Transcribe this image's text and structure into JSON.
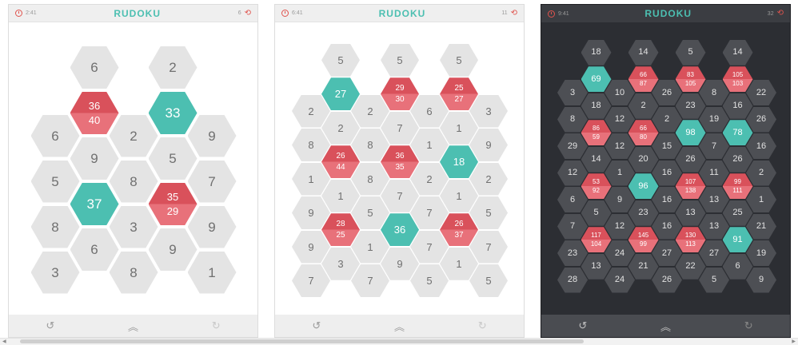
{
  "screens": [
    {
      "id": "s1",
      "theme": "light",
      "time": "2:41",
      "moves": "6",
      "title": "RUDOKU",
      "bottom_icons": [
        "undo-icon",
        "menu-icon",
        "redo-icon"
      ],
      "cells": [
        {
          "c": 1,
          "r": 1,
          "v": [
            "6"
          ]
        },
        {
          "c": 3,
          "r": 1,
          "v": [
            "2"
          ]
        },
        {
          "c": 0,
          "r": 2,
          "v": [
            "6"
          ]
        },
        {
          "c": 1,
          "r": 2,
          "v": [
            "36",
            "40"
          ],
          "t": "red"
        },
        {
          "c": 2,
          "r": 2,
          "v": [
            "2"
          ]
        },
        {
          "c": 3,
          "r": 2,
          "v": [
            "33"
          ],
          "t": "teal"
        },
        {
          "c": 4,
          "r": 2,
          "v": [
            "9"
          ]
        },
        {
          "c": 0,
          "r": 3,
          "v": [
            "5"
          ]
        },
        {
          "c": 1,
          "r": 3,
          "v": [
            "9"
          ]
        },
        {
          "c": 2,
          "r": 3,
          "v": [
            "8"
          ]
        },
        {
          "c": 3,
          "r": 3,
          "v": [
            "5"
          ]
        },
        {
          "c": 4,
          "r": 3,
          "v": [
            "7"
          ]
        },
        {
          "c": 0,
          "r": 4,
          "v": [
            "8"
          ]
        },
        {
          "c": 1,
          "r": 4,
          "v": [
            "37"
          ],
          "t": "teal"
        },
        {
          "c": 2,
          "r": 4,
          "v": [
            "3"
          ]
        },
        {
          "c": 3,
          "r": 4,
          "v": [
            "35",
            "29"
          ],
          "t": "red"
        },
        {
          "c": 4,
          "r": 4,
          "v": [
            "9"
          ]
        },
        {
          "c": 0,
          "r": 5,
          "v": [
            "3"
          ]
        },
        {
          "c": 1,
          "r": 5,
          "v": [
            "6"
          ]
        },
        {
          "c": 2,
          "r": 5,
          "v": [
            "8"
          ]
        },
        {
          "c": 3,
          "r": 5,
          "v": [
            "9"
          ]
        },
        {
          "c": 4,
          "r": 5,
          "v": [
            "1"
          ]
        }
      ]
    },
    {
      "id": "s2",
      "theme": "light",
      "time": "6:41",
      "moves": "11",
      "title": "RUDOKU",
      "bottom_icons": [
        "undo-icon",
        "menu-icon",
        "redo-icon"
      ],
      "cells": [
        {
          "c": 1,
          "r": 1,
          "v": [
            "5"
          ]
        },
        {
          "c": 3,
          "r": 1,
          "v": [
            "5"
          ]
        },
        {
          "c": 5,
          "r": 1,
          "v": [
            "5"
          ]
        },
        {
          "c": 0,
          "r": 2,
          "v": [
            "2"
          ]
        },
        {
          "c": 1,
          "r": 2,
          "v": [
            "27"
          ],
          "t": "teal"
        },
        {
          "c": 2,
          "r": 2,
          "v": [
            "2"
          ]
        },
        {
          "c": 3,
          "r": 2,
          "v": [
            "29",
            "30"
          ],
          "t": "red"
        },
        {
          "c": 4,
          "r": 2,
          "v": [
            "6"
          ]
        },
        {
          "c": 5,
          "r": 2,
          "v": [
            "25",
            "27"
          ],
          "t": "red"
        },
        {
          "c": 6,
          "r": 2,
          "v": [
            "3"
          ]
        },
        {
          "c": 0,
          "r": 3,
          "v": [
            "8"
          ]
        },
        {
          "c": 1,
          "r": 3,
          "v": [
            "2"
          ]
        },
        {
          "c": 2,
          "r": 3,
          "v": [
            "8"
          ]
        },
        {
          "c": 3,
          "r": 3,
          "v": [
            "7"
          ]
        },
        {
          "c": 4,
          "r": 3,
          "v": [
            "1"
          ]
        },
        {
          "c": 5,
          "r": 3,
          "v": [
            "1"
          ]
        },
        {
          "c": 6,
          "r": 3,
          "v": [
            "9"
          ]
        },
        {
          "c": 0,
          "r": 4,
          "v": [
            "1"
          ]
        },
        {
          "c": 1,
          "r": 4,
          "v": [
            "26",
            "44"
          ],
          "t": "red"
        },
        {
          "c": 2,
          "r": 4,
          "v": [
            "8"
          ]
        },
        {
          "c": 3,
          "r": 4,
          "v": [
            "36",
            "35"
          ],
          "t": "red"
        },
        {
          "c": 4,
          "r": 4,
          "v": [
            "2"
          ]
        },
        {
          "c": 5,
          "r": 4,
          "v": [
            "18"
          ],
          "t": "teal"
        },
        {
          "c": 6,
          "r": 4,
          "v": [
            "2"
          ]
        },
        {
          "c": 0,
          "r": 5,
          "v": [
            "9"
          ]
        },
        {
          "c": 1,
          "r": 5,
          "v": [
            "1"
          ]
        },
        {
          "c": 2,
          "r": 5,
          "v": [
            "5"
          ]
        },
        {
          "c": 3,
          "r": 5,
          "v": [
            "7"
          ]
        },
        {
          "c": 4,
          "r": 5,
          "v": [
            "7"
          ]
        },
        {
          "c": 5,
          "r": 5,
          "v": [
            "1"
          ]
        },
        {
          "c": 6,
          "r": 5,
          "v": [
            "5"
          ]
        },
        {
          "c": 0,
          "r": 6,
          "v": [
            "9"
          ]
        },
        {
          "c": 1,
          "r": 6,
          "v": [
            "28",
            "25"
          ],
          "t": "red"
        },
        {
          "c": 2,
          "r": 6,
          "v": [
            "1"
          ]
        },
        {
          "c": 3,
          "r": 6,
          "v": [
            "36"
          ],
          "t": "teal"
        },
        {
          "c": 4,
          "r": 6,
          "v": [
            "7"
          ]
        },
        {
          "c": 5,
          "r": 6,
          "v": [
            "26",
            "37"
          ],
          "t": "red"
        },
        {
          "c": 6,
          "r": 6,
          "v": [
            "7"
          ]
        },
        {
          "c": 0,
          "r": 7,
          "v": [
            "7"
          ]
        },
        {
          "c": 1,
          "r": 7,
          "v": [
            "3"
          ]
        },
        {
          "c": 2,
          "r": 7,
          "v": [
            "7"
          ]
        },
        {
          "c": 3,
          "r": 7,
          "v": [
            "9"
          ]
        },
        {
          "c": 4,
          "r": 7,
          "v": [
            "5"
          ]
        },
        {
          "c": 5,
          "r": 7,
          "v": [
            "1"
          ]
        },
        {
          "c": 6,
          "r": 7,
          "v": [
            "5"
          ]
        }
      ]
    },
    {
      "id": "s3",
      "theme": "dark",
      "time": "9:41",
      "moves": "32",
      "title": "RUDOKU",
      "bottom_icons": [
        "undo-icon",
        "menu-icon",
        "redo-icon"
      ],
      "cells": [
        {
          "c": 1,
          "r": 1,
          "v": [
            "18"
          ]
        },
        {
          "c": 3,
          "r": 1,
          "v": [
            "14"
          ]
        },
        {
          "c": 5,
          "r": 1,
          "v": [
            "5"
          ]
        },
        {
          "c": 7,
          "r": 1,
          "v": [
            "14"
          ]
        },
        {
          "c": 0,
          "r": 2,
          "v": [
            "3"
          ]
        },
        {
          "c": 1,
          "r": 2,
          "v": [
            "69"
          ],
          "t": "teal"
        },
        {
          "c": 2,
          "r": 2,
          "v": [
            "10"
          ]
        },
        {
          "c": 3,
          "r": 2,
          "v": [
            "66",
            "87"
          ],
          "t": "red"
        },
        {
          "c": 4,
          "r": 2,
          "v": [
            "26"
          ]
        },
        {
          "c": 5,
          "r": 2,
          "v": [
            "83",
            "105"
          ],
          "t": "red"
        },
        {
          "c": 6,
          "r": 2,
          "v": [
            "8"
          ]
        },
        {
          "c": 7,
          "r": 2,
          "v": [
            "105",
            "103"
          ],
          "t": "red"
        },
        {
          "c": 8,
          "r": 2,
          "v": [
            "22"
          ]
        },
        {
          "c": 0,
          "r": 3,
          "v": [
            "8"
          ]
        },
        {
          "c": 1,
          "r": 3,
          "v": [
            "18"
          ]
        },
        {
          "c": 2,
          "r": 3,
          "v": [
            "12"
          ]
        },
        {
          "c": 3,
          "r": 3,
          "v": [
            "2"
          ]
        },
        {
          "c": 4,
          "r": 3,
          "v": [
            "2"
          ]
        },
        {
          "c": 5,
          "r": 3,
          "v": [
            "23"
          ]
        },
        {
          "c": 6,
          "r": 3,
          "v": [
            "19"
          ]
        },
        {
          "c": 7,
          "r": 3,
          "v": [
            "16"
          ]
        },
        {
          "c": 8,
          "r": 3,
          "v": [
            "26"
          ]
        },
        {
          "c": 0,
          "r": 4,
          "v": [
            "29"
          ]
        },
        {
          "c": 1,
          "r": 4,
          "v": [
            "86",
            "59"
          ],
          "t": "red"
        },
        {
          "c": 2,
          "r": 4,
          "v": [
            "12"
          ]
        },
        {
          "c": 3,
          "r": 4,
          "v": [
            "66",
            "80"
          ],
          "t": "red"
        },
        {
          "c": 4,
          "r": 4,
          "v": [
            "15"
          ]
        },
        {
          "c": 5,
          "r": 4,
          "v": [
            "98"
          ],
          "t": "teal"
        },
        {
          "c": 6,
          "r": 4,
          "v": [
            "7"
          ]
        },
        {
          "c": 7,
          "r": 4,
          "v": [
            "78"
          ],
          "t": "teal"
        },
        {
          "c": 8,
          "r": 4,
          "v": [
            "16"
          ]
        },
        {
          "c": 0,
          "r": 5,
          "v": [
            "12"
          ]
        },
        {
          "c": 1,
          "r": 5,
          "v": [
            "14"
          ]
        },
        {
          "c": 2,
          "r": 5,
          "v": [
            "1"
          ]
        },
        {
          "c": 3,
          "r": 5,
          "v": [
            "20"
          ]
        },
        {
          "c": 4,
          "r": 5,
          "v": [
            "16"
          ]
        },
        {
          "c": 5,
          "r": 5,
          "v": [
            "26"
          ]
        },
        {
          "c": 6,
          "r": 5,
          "v": [
            "11"
          ]
        },
        {
          "c": 7,
          "r": 5,
          "v": [
            "26"
          ]
        },
        {
          "c": 8,
          "r": 5,
          "v": [
            "2"
          ]
        },
        {
          "c": 0,
          "r": 6,
          "v": [
            "6"
          ]
        },
        {
          "c": 1,
          "r": 6,
          "v": [
            "53",
            "92"
          ],
          "t": "red"
        },
        {
          "c": 2,
          "r": 6,
          "v": [
            "9"
          ]
        },
        {
          "c": 3,
          "r": 6,
          "v": [
            "96"
          ],
          "t": "teal"
        },
        {
          "c": 4,
          "r": 6,
          "v": [
            "16"
          ]
        },
        {
          "c": 5,
          "r": 6,
          "v": [
            "107",
            "138"
          ],
          "t": "red"
        },
        {
          "c": 6,
          "r": 6,
          "v": [
            "13"
          ]
        },
        {
          "c": 7,
          "r": 6,
          "v": [
            "99",
            "111"
          ],
          "t": "red"
        },
        {
          "c": 8,
          "r": 6,
          "v": [
            "1"
          ]
        },
        {
          "c": 0,
          "r": 7,
          "v": [
            "7"
          ]
        },
        {
          "c": 1,
          "r": 7,
          "v": [
            "5"
          ]
        },
        {
          "c": 2,
          "r": 7,
          "v": [
            "12"
          ]
        },
        {
          "c": 3,
          "r": 7,
          "v": [
            "23"
          ]
        },
        {
          "c": 4,
          "r": 7,
          "v": [
            "16"
          ]
        },
        {
          "c": 5,
          "r": 7,
          "v": [
            "13"
          ]
        },
        {
          "c": 6,
          "r": 7,
          "v": [
            "13"
          ]
        },
        {
          "c": 7,
          "r": 7,
          "v": [
            "25"
          ]
        },
        {
          "c": 8,
          "r": 7,
          "v": [
            "21"
          ]
        },
        {
          "c": 0,
          "r": 8,
          "v": [
            "23"
          ]
        },
        {
          "c": 1,
          "r": 8,
          "v": [
            "117",
            "104"
          ],
          "t": "red"
        },
        {
          "c": 2,
          "r": 8,
          "v": [
            "24"
          ]
        },
        {
          "c": 3,
          "r": 8,
          "v": [
            "145",
            "99"
          ],
          "t": "red"
        },
        {
          "c": 4,
          "r": 8,
          "v": [
            "27"
          ]
        },
        {
          "c": 5,
          "r": 8,
          "v": [
            "130",
            "113"
          ],
          "t": "red"
        },
        {
          "c": 6,
          "r": 8,
          "v": [
            "27"
          ]
        },
        {
          "c": 7,
          "r": 8,
          "v": [
            "91"
          ],
          "t": "teal"
        },
        {
          "c": 8,
          "r": 8,
          "v": [
            "19"
          ]
        },
        {
          "c": 0,
          "r": 9,
          "v": [
            "28"
          ]
        },
        {
          "c": 1,
          "r": 9,
          "v": [
            "13"
          ]
        },
        {
          "c": 2,
          "r": 9,
          "v": [
            "24"
          ]
        },
        {
          "c": 3,
          "r": 9,
          "v": [
            "21"
          ]
        },
        {
          "c": 4,
          "r": 9,
          "v": [
            "26"
          ]
        },
        {
          "c": 5,
          "r": 9,
          "v": [
            "22"
          ]
        },
        {
          "c": 6,
          "r": 9,
          "v": [
            "5"
          ]
        },
        {
          "c": 7,
          "r": 9,
          "v": [
            "6"
          ]
        },
        {
          "c": 8,
          "r": 9,
          "v": [
            "9"
          ]
        }
      ]
    }
  ],
  "colors": {
    "teal": "#4cbfb1",
    "red": "#d9515b",
    "light_hex": "#e4e4e4",
    "dark_hex": "#4d4f54",
    "dark_bg": "#2c2e33"
  }
}
